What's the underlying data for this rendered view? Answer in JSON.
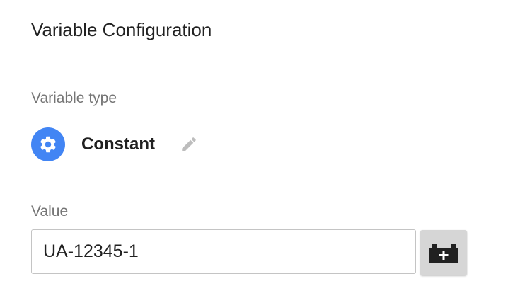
{
  "panel": {
    "title": "Variable Configuration"
  },
  "variable_type": {
    "label": "Variable type",
    "name": "Constant",
    "icon": "gear-icon",
    "icon_bg_color": "#4285f4",
    "edit_icon": "pencil-icon"
  },
  "value": {
    "label": "Value",
    "input_value": "UA-12345-1",
    "insert_variable_icon": "variable-brick-plus-icon"
  }
}
